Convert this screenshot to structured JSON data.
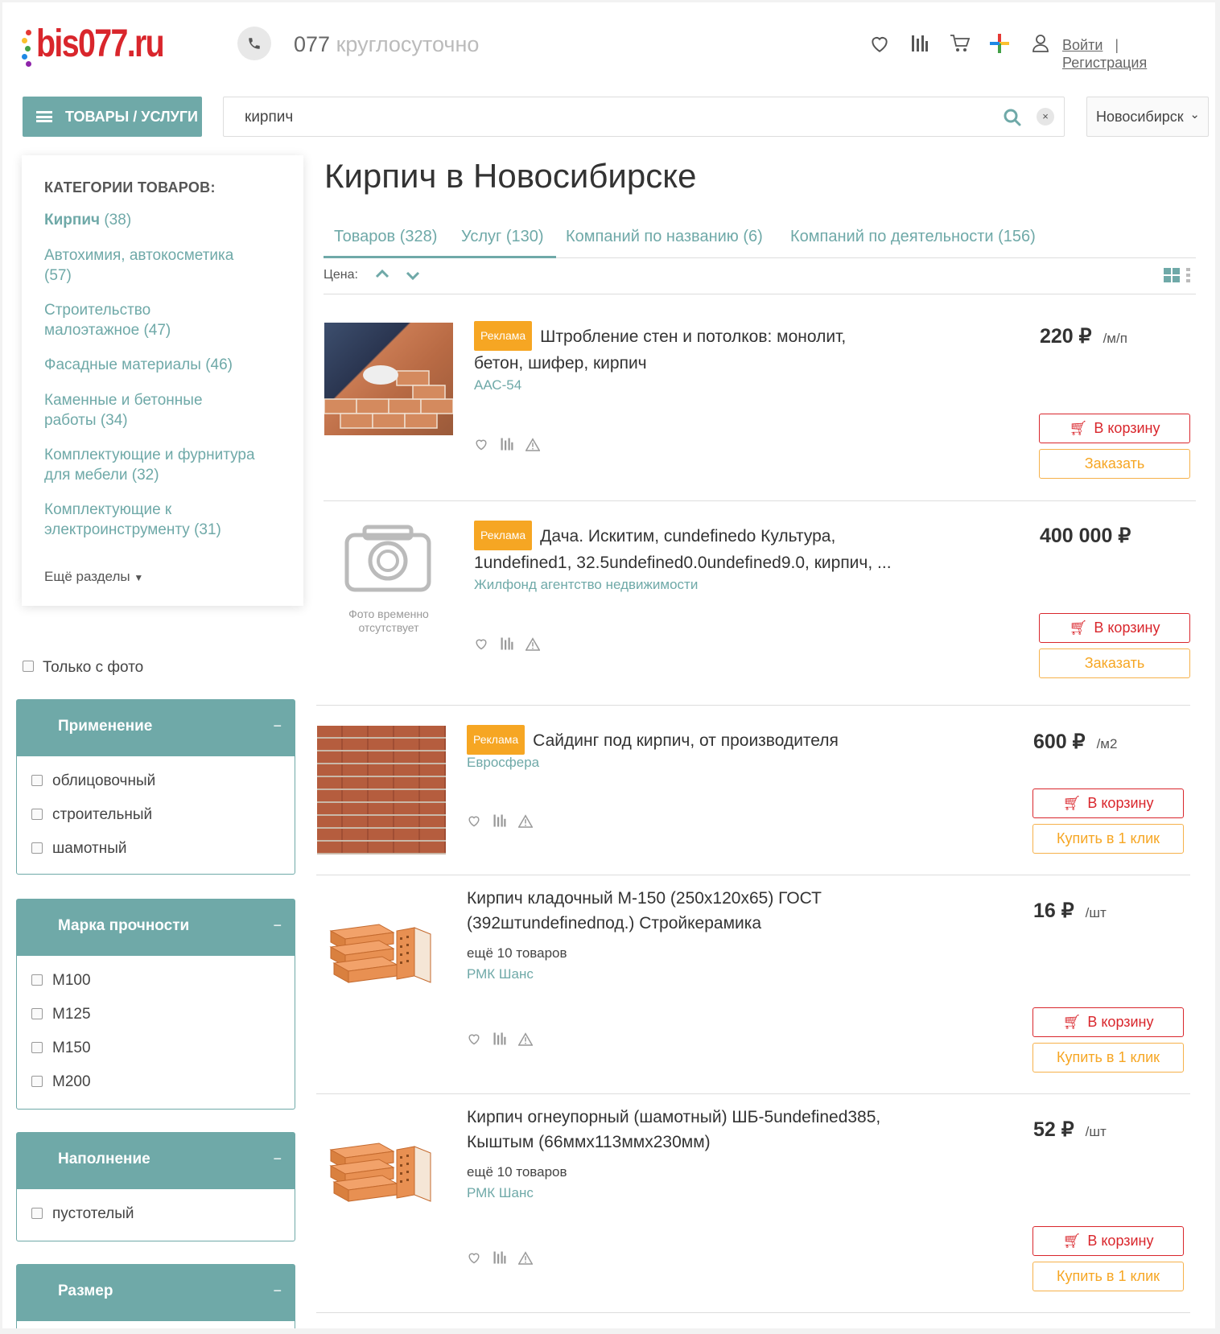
{
  "header": {
    "logo_text": "bis077.ru",
    "phone_number": "077",
    "phone_note": "круглосуточно",
    "login": "Войти",
    "register": "Регистрация",
    "separator": "|"
  },
  "toolbar": {
    "catalog_button": "ТОВАРЫ / УСЛУГИ",
    "search_value": "кирпич",
    "clear_label": "×",
    "city": "Новосибирск"
  },
  "sidebar": {
    "heading": "КАТЕГОРИИ ТОВАРОВ:",
    "categories": [
      {
        "name": "Кирпич",
        "count": "(38)"
      },
      {
        "name": "Автохимия, автокосметика",
        "count": "(57)"
      },
      {
        "name": "Строительство малоэтажное",
        "count": "(47)"
      },
      {
        "name": "Фасадные материалы",
        "count": "(46)"
      },
      {
        "name": "Каменные и бетонные работы",
        "count": "(34)"
      },
      {
        "name": "Комплектующие и фурнитура для мебели",
        "count": "(32)"
      },
      {
        "name": "Комплектующие к электроинструменту",
        "count": "(31)"
      }
    ],
    "more_label": "Ещё разделы"
  },
  "filters": {
    "only_photo": "Только с фото",
    "groups": [
      {
        "title": "Применение",
        "toggle": "−",
        "options": [
          "облицовочный",
          "строительный",
          "шамотный"
        ]
      },
      {
        "title": "Марка прочности",
        "toggle": "−",
        "options": [
          "M100",
          "M125",
          "M150",
          "M200"
        ]
      },
      {
        "title": "Наполнение",
        "toggle": "−",
        "options": [
          "пустотелый"
        ]
      },
      {
        "title": "Размер",
        "toggle": "−",
        "options": []
      }
    ]
  },
  "main": {
    "title": "Кирпич в Новосибирске",
    "tabs": [
      {
        "label": "Товаров (328)"
      },
      {
        "label": "Услуг (130)"
      },
      {
        "label": "Компаний по названию (6)"
      },
      {
        "label": "Компаний по деятельности (156)"
      }
    ],
    "sort_label": "Цена:",
    "ad_badge": "Реклама",
    "no_photo": "Фото временно отсутствует",
    "items": [
      {
        "title": "Штробление стен и потолков: монолит, бетон, шифер, кирпич",
        "vendor": "ААС-54",
        "price": "220 ₽",
        "unit": "/м/п",
        "cart": "В корзину",
        "order": "Заказать",
        "ad": true
      },
      {
        "title": "Дача. Искитим, cundefinedo Культура, 1undefined1, 32.5undefined0.0undefined9.0, кирпич, ...",
        "vendor": "Жилфонд агентство недвижимости",
        "price": "400 000 ₽",
        "unit": "",
        "cart": "В корзину",
        "order": "Заказать",
        "ad": true
      },
      {
        "title": "Сайдинг под кирпич, от производителя",
        "vendor": "Евросфера",
        "price": "600 ₽",
        "unit": "/м2",
        "cart": "В корзину",
        "order": "Купить в 1 клик",
        "ad": true
      },
      {
        "title": "Кирпич кладочный М-150 (250х120х65) ГОСТ (392штundefinedпод.) Стройкерамика",
        "more": "ещё 10 товаров",
        "vendor": "РМК Шанс",
        "price": "16 ₽",
        "unit": "/шт",
        "cart": "В корзину",
        "order": "Купить в 1 клик",
        "ad": false
      },
      {
        "title": "Кирпич огнеупорный (шамотный) ШБ-5undefined385, Кыштым (66ммх113ммх230мм)",
        "more": "ещё 10 товаров",
        "vendor": "РМК Шанс",
        "price": "52 ₽",
        "unit": "/шт",
        "cart": "В корзину",
        "order": "Купить в 1 клик",
        "ad": false
      }
    ]
  },
  "colors": {
    "accent": "#6fa9a8",
    "brand_red": "#d9262c",
    "ad_orange": "#f6a623"
  }
}
